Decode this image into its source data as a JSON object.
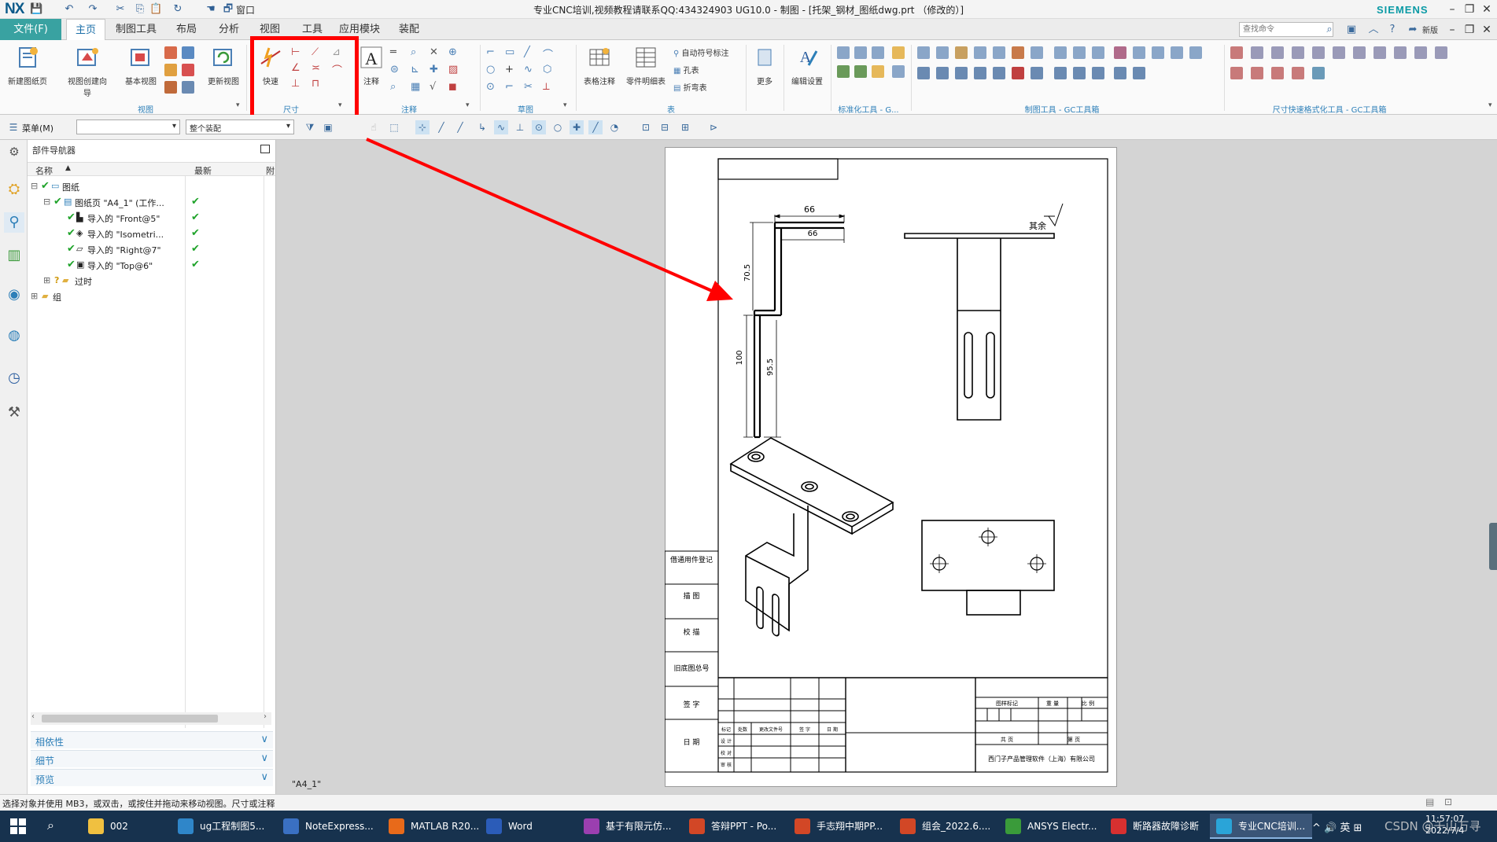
{
  "app": {
    "logo": "NX",
    "title": "专业CNC培训,视频教程请联系QQ:434324903 UG10.0 - 制图 - [托架_钢材_图纸dwg.prt （修改的）]",
    "brand": "SIEMENS",
    "quick_access_window": "窗口"
  },
  "tabs": {
    "file": "文件(F)",
    "items": [
      "主页",
      "制图工具",
      "布局",
      "分析",
      "视图",
      "工具",
      "应用模块",
      "装配"
    ],
    "active": "主页",
    "command_search_placeholder": "查找命令",
    "right_labels": [
      "新版"
    ]
  },
  "ribbon": {
    "groups": {
      "view": {
        "label": "视图",
        "buttons": [
          "新建图纸页",
          "视图创建向导",
          "基本视图",
          "更新视图"
        ]
      },
      "dimension": {
        "label": "尺寸",
        "buttons": [
          "快速"
        ]
      },
      "annotation": {
        "label": "注释",
        "buttons": [
          "注释"
        ]
      },
      "sketch": {
        "label": "草图"
      },
      "table": {
        "label": "表",
        "buttons": [
          "表格注释",
          "零件明细表"
        ],
        "small": [
          "自动符号标注",
          "孔表",
          "折弯表"
        ]
      },
      "more": {
        "label": "更多"
      },
      "edit": {
        "label": "编辑设置"
      },
      "std": {
        "label": "标准化工具 - G..."
      },
      "gc": {
        "label": "制图工具 - GC工具箱"
      },
      "dimfast": {
        "label": "尺寸快速格式化工具 - GC工具箱"
      }
    }
  },
  "toolbar2": {
    "menu": "菜单(M)",
    "filter_value": "",
    "scope_value": "整个装配"
  },
  "navigator": {
    "title": "部件导航器",
    "columns": [
      "名称",
      "最新",
      "附"
    ],
    "rows": [
      {
        "label": "图纸",
        "indent": 0,
        "check": false
      },
      {
        "label": "图纸页 \"A4_1\" (工作...",
        "indent": 1,
        "check": true
      },
      {
        "label": "导入的 \"Front@5\"",
        "indent": 2,
        "check": true
      },
      {
        "label": "导入的 \"Isometri...",
        "indent": 2,
        "check": true
      },
      {
        "label": "导入的 \"Right@7\"",
        "indent": 2,
        "check": true
      },
      {
        "label": "导入的 \"Top@6\"",
        "indent": 2,
        "check": true
      },
      {
        "label": "过时",
        "indent": 1,
        "check": false
      },
      {
        "label": "组",
        "indent": 0,
        "check": false
      }
    ],
    "panels": [
      "相依性",
      "细节",
      "预览"
    ]
  },
  "drawing": {
    "sheet_name": "\"A4_1\"",
    "dims": {
      "top_width": "66",
      "inner_width": "66",
      "upper_height": "70.5",
      "lower_height": "100",
      "inner_height": "95.5"
    },
    "surface_note": "其余",
    "left_strip": [
      "借通用件登记",
      "描  图",
      "校  描",
      "旧底图总号",
      "签  字",
      "日  期"
    ],
    "title_block": {
      "company": "西门子产品管理软件（上海）有限公司",
      "mark_cells": [
        "图样标记",
        "重 量",
        "比 例"
      ],
      "rev_cells": [
        "标记",
        "处数",
        "更改文件号",
        "签 字",
        "日 期"
      ],
      "role_cells": [
        "设 计",
        "校 对",
        "审 核",
        "批 准"
      ],
      "sheet_cells": [
        "共  页",
        "第  页"
      ]
    }
  },
  "status": {
    "text": "选择对象并使用 MB3，或双击，或按住并拖动来移动视图。尺寸或注释"
  },
  "taskbar": {
    "items": [
      {
        "label": "002",
        "color": "#f0c040"
      },
      {
        "label": "ug工程制图5...",
        "color": "#2f86c9"
      },
      {
        "label": "NoteExpress...",
        "color": "#3a70c2"
      },
      {
        "label": "MATLAB R20...",
        "color": "#e86a1a"
      },
      {
        "label": "Word",
        "color": "#2b5cb8"
      },
      {
        "label": "基于有限元仿...",
        "color": "#9b3fb0"
      },
      {
        "label": "答辩PPT - Po...",
        "color": "#d24726"
      },
      {
        "label": "手志翔中期PP...",
        "color": "#d24726"
      },
      {
        "label": "组会_2022.6....",
        "color": "#d24726"
      },
      {
        "label": "ANSYS Electr...",
        "color": "#3a9b3a"
      },
      {
        "label": "断路器故障诊断",
        "color": "#d73030"
      },
      {
        "label": "专业CNC培训...",
        "color": "#2aa4d8"
      }
    ],
    "tray": "^ 🔊 英 ⊞",
    "time": "11:57:07",
    "date": "2022/7/4"
  },
  "watermark": "CSDN @千山万寻",
  "colors": {
    "accent": "#39a2a1",
    "highlight": "#ff0000",
    "check": "#1fa32a"
  }
}
